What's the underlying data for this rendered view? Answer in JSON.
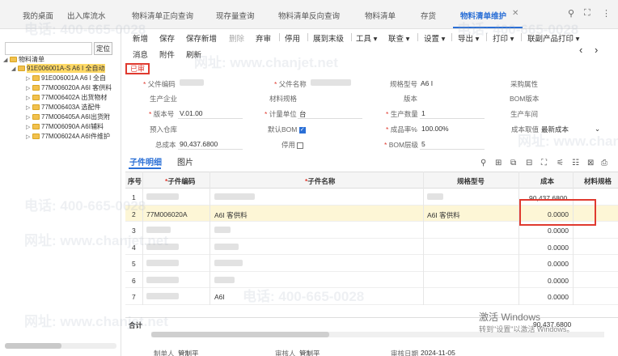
{
  "tabs": [
    "我的桌面",
    "出入库流水",
    "物料清单正向查询",
    "现存量查询",
    "物料清单反向查询",
    "物料清单",
    "存货",
    "物料清单维护"
  ],
  "tab_close": "✕",
  "left": {
    "search_button": "定位",
    "tree": [
      {
        "label": "物料清单",
        "level": 0,
        "toggle": "◢"
      },
      {
        "label": "91E006001A-S A6 I 全自动",
        "level": 1,
        "toggle": "◢",
        "selected": true
      },
      {
        "label": "91E006001A A6 I 全自",
        "level": 2,
        "toggle": "▷"
      },
      {
        "label": "77M006020A A6I 客供料",
        "level": 2,
        "toggle": "▷"
      },
      {
        "label": "77M006402A 出货物材",
        "level": 2,
        "toggle": "▷"
      },
      {
        "label": "77M006403A 选配件",
        "level": 2,
        "toggle": "▷"
      },
      {
        "label": "77M006405A A6I出货附",
        "level": 2,
        "toggle": "▷"
      },
      {
        "label": "77M006090A A6I辅料",
        "level": 2,
        "toggle": "▷"
      },
      {
        "label": "77M006024A A6I件维护",
        "level": 2,
        "toggle": "▷"
      }
    ]
  },
  "toolbar": {
    "items": [
      "新增",
      "保存",
      "保存新增",
      "删除",
      "弃审",
      "停用",
      "展到末级",
      "工具",
      "联查",
      "设置",
      "导出",
      "打印",
      "联副产品打印"
    ],
    "row2": [
      "消息",
      "附件",
      "刷新"
    ],
    "prev": "‹",
    "next": "›"
  },
  "status": "已审",
  "form": {
    "parent_code_label": "父件编码",
    "parent_name_label": "父件名称",
    "spec_label": "规格型号",
    "spec_value": "A6 I",
    "purchase_attr_label": "采购属性",
    "company_label": "生产企业",
    "material_spec_label": "材料规格",
    "version_label": "版本",
    "bom_version_label": "BOM版本",
    "version_no_label": "版本号",
    "version_no_value": "V.01.00",
    "unit_label": "计量单位",
    "unit_value": "台",
    "prod_qty_label": "生产数量",
    "prod_qty_value": "1",
    "workshop_label": "生产车间",
    "warehouse_label": "预入仓库",
    "default_bom_label": "默认BOM",
    "yield_label": "成品率%",
    "yield_value": "100.00%",
    "cost_source_label": "成本取值",
    "cost_source_value": "最新成本",
    "total_cost_label": "总成本",
    "total_cost_value": "90,437.6800",
    "disabled_label": "停用",
    "bom_level_label": "BOM层级",
    "bom_level_value": "5"
  },
  "subtabs": [
    "子件明细",
    "图片"
  ],
  "grid": {
    "headers": [
      "序号",
      "子件编码",
      "子件名称",
      "规格型号",
      "成本",
      "材料规格"
    ],
    "rows": [
      {
        "no": "1",
        "code": "",
        "name": "",
        "spec": "",
        "cost": "90,437.6800"
      },
      {
        "no": "2",
        "code": "77M006020A",
        "name": "A6I 客供料",
        "spec": "A6I 客供料",
        "cost": "0.0000"
      },
      {
        "no": "3",
        "code": "",
        "name": "",
        "spec": "",
        "cost": "0.0000"
      },
      {
        "no": "4",
        "code": "",
        "name": "",
        "spec": "",
        "cost": "0.0000"
      },
      {
        "no": "5",
        "code": "",
        "name": "",
        "spec": "",
        "cost": "0.0000"
      },
      {
        "no": "6",
        "code": "",
        "name": "",
        "spec": "",
        "cost": "0.0000"
      },
      {
        "no": "7",
        "code": "",
        "name": "A6I",
        "spec": "",
        "cost": "0.0000"
      }
    ],
    "total_label": "合计",
    "total_value": "90,437.6800"
  },
  "footer": {
    "maker_label": "制单人",
    "maker_value": "管制平",
    "auditor_label": "审核人",
    "auditor_value": "管制平",
    "audit_date_label": "审核日期",
    "audit_date_value": "2024-11-05"
  },
  "watermarks": [
    "电话: 400-665-0028",
    "网址: www.chanjet.net"
  ],
  "windows_activation": {
    "title": "激活 Windows",
    "sub": "转到\"设置\"以激活 Windows。"
  }
}
